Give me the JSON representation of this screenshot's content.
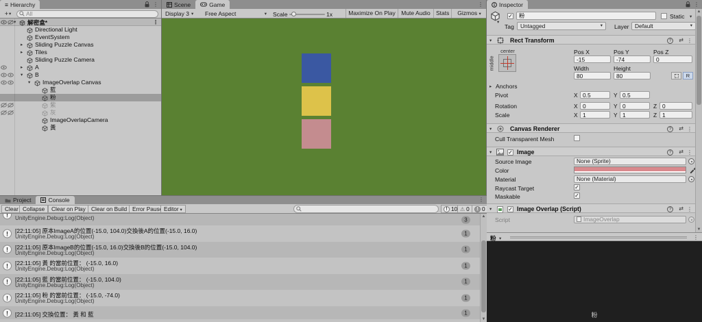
{
  "hierarchy": {
    "tab_label": "Hierarchy",
    "add_button": "+",
    "search_placeholder": "All",
    "scene_name": "解密盒*",
    "items": [
      {
        "label": "Directional Light",
        "indent": 1
      },
      {
        "label": "EventSystem",
        "indent": 1
      },
      {
        "label": "Sliding Puzzle Canvas",
        "indent": 1,
        "arrow": "closed"
      },
      {
        "label": "Tiles",
        "indent": 1,
        "arrow": "closed"
      },
      {
        "label": "Sliding Puzzle Camera",
        "indent": 1
      },
      {
        "label": "A",
        "indent": 1,
        "arrow": "closed",
        "toggles": "a"
      },
      {
        "label": "B",
        "indent": 1,
        "arrow": "open",
        "toggles": "ab"
      },
      {
        "label": "ImageOverlap Canvas",
        "indent": 2,
        "arrow": "open",
        "toggles": "ab"
      },
      {
        "label": "藍",
        "indent": 3
      },
      {
        "label": "粉",
        "indent": 3,
        "selected": true
      },
      {
        "label": "紫",
        "indent": 3,
        "disabled": true,
        "toggles": "off"
      },
      {
        "label": "灰",
        "indent": 3,
        "disabled": true,
        "toggles": "off"
      },
      {
        "label": "ImageOverlapCamera",
        "indent": 3
      },
      {
        "label": "黃",
        "indent": 3
      }
    ]
  },
  "game": {
    "tab_scene": "Scene",
    "tab_game": "Game",
    "display": "Display 3",
    "aspect": "Free Aspect",
    "scale_label": "Scale",
    "scale_value": "1x",
    "maximize_label": "Maximize On Play",
    "mute_label": "Mute Audio",
    "stats_label": "Stats",
    "gizmos_label": "Gizmos",
    "viewport_color": "#5a8132",
    "squares": [
      {
        "name": "blue",
        "color": "#3a58a2"
      },
      {
        "name": "yellow",
        "color": "#ddc24a"
      },
      {
        "name": "pink",
        "color": "#c48c8f"
      }
    ]
  },
  "console": {
    "tab_project": "Project",
    "tab_console": "Console",
    "buttons": [
      {
        "label": "Clear"
      },
      {
        "label": "Collapse"
      },
      {
        "label": "Clear on Play"
      },
      {
        "label": "Clear on Build"
      },
      {
        "label": "Error Pause"
      },
      {
        "label": "Editor",
        "caret": true
      }
    ],
    "info_count": "10",
    "warning_count": "0",
    "error_count": "0",
    "rows": [
      {
        "trace": "UnityEngine.Debug:Log(Object)",
        "count": "3",
        "partial": true
      },
      {
        "message": "[22:11:05] 原本ImageA的位置(-15.0, 104.0)交換後A的位置(-15.0, 16.0)",
        "trace": "UnityEngine.Debug:Log(Object)",
        "count": "1"
      },
      {
        "message": "[22:11:05] 原本ImageB的位置(-15.0, 16.0)交換後B的位置(-15.0, 104.0)",
        "trace": "UnityEngine.Debug:Log(Object)",
        "count": "1"
      },
      {
        "message": "[22:11:05] 黃 的當前位置： (-15.0, 16.0)",
        "trace": "UnityEngine.Debug:Log(Object)",
        "count": "1"
      },
      {
        "message": "[22:11:05] 藍 的當前位置： (-15.0, 104.0)",
        "trace": "UnityEngine.Debug:Log(Object)",
        "count": "1"
      },
      {
        "message": "[22:11:05] 粉 的當前位置： (-15.0, -74.0)",
        "trace": "UnityEngine.Debug:Log(Object)",
        "count": "1"
      },
      {
        "message": "[22:11:05] 交換位置： 黃 和 藍",
        "count": "1",
        "cut": true
      }
    ]
  },
  "inspector": {
    "tab_label": "Inspector",
    "name": "粉",
    "static_label": "Static",
    "tag_label": "Tag",
    "tag_value": "Untagged",
    "layer_label": "Layer",
    "layer_value": "Default",
    "rect_transform": {
      "title": "Rect Transform",
      "anchor_h": "center",
      "anchor_v": "middle",
      "pos_x_label": "Pos X",
      "pos_y_label": "Pos Y",
      "pos_z_label": "Pos Z",
      "pos_x": "-15",
      "pos_y": "-74",
      "pos_z": "0",
      "width_label": "Width",
      "height_label": "Height",
      "width": "80",
      "height": "80",
      "anchors_label": "Anchors",
      "pivot_label": "Pivot",
      "rotation_label": "Rotation",
      "scale_label": "Scale",
      "x": "X",
      "y": "Y",
      "z": "Z",
      "pivot_x": "0.5",
      "pivot_y": "0.5",
      "rot_x": "0",
      "rot_y": "0",
      "rot_z": "0",
      "scl_x": "1",
      "scl_y": "1",
      "scl_z": "1",
      "r_button": "R"
    },
    "canvas_renderer": {
      "title": "Canvas Renderer",
      "cull_label": "Cull Transparent Mesh"
    },
    "image": {
      "title": "Image",
      "source_label": "Source Image",
      "source_value": "None (Sprite)",
      "color_label": "Color",
      "color_hex": "#d9898d",
      "material_label": "Material",
      "material_value": "None (Material)",
      "raycast_label": "Raycast Target",
      "maskable_label": "Maskable"
    },
    "script_component": {
      "title": "Image Overlap (Script)",
      "script_label": "Script",
      "script_value": "ImageOverlap"
    },
    "preview": {
      "header_label": "粉",
      "preview_label": "粉"
    }
  }
}
